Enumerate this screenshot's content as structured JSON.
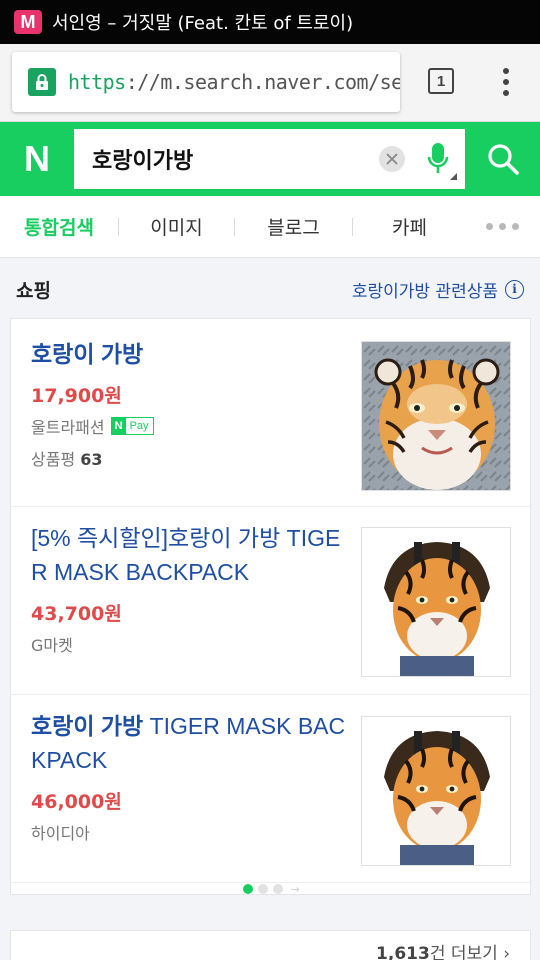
{
  "status_bar": {
    "app_badge": "M",
    "now_playing": "서인영 – 거짓말 (Feat. 칸토 of 트로이)"
  },
  "browser": {
    "url_scheme": "https",
    "url_rest": "://m.search.naver.com/sea",
    "tab_count": "1"
  },
  "naver": {
    "logo": "N",
    "query": "호랑이가방"
  },
  "tabs": [
    {
      "label": "통합검색",
      "active": true
    },
    {
      "label": "이미지",
      "active": false
    },
    {
      "label": "블로그",
      "active": false
    },
    {
      "label": "카페",
      "active": false
    }
  ],
  "shopping": {
    "section_title": "쇼핑",
    "related_link": "호랑이가방 관련상품",
    "info_glyph": "i",
    "products": [
      {
        "title_highlight": "호랑이 가방",
        "title_rest": "",
        "price": "17,900",
        "currency": "원",
        "mall": "울트라패션",
        "npay_n": "N",
        "npay_text": "Pay",
        "review_label": "상품평",
        "review_count": "63"
      },
      {
        "title_highlight": "[5% 즉시할인]호랑이 가방",
        "title_rest": " TIGER MASK BACKPACK",
        "price": "43,700",
        "currency": "원",
        "mall": "G마켓"
      },
      {
        "title_highlight": "호랑이 가방",
        "title_rest": " TIGER MASK BACKPACK",
        "price": "46,000",
        "currency": "원",
        "mall": "하이디아"
      }
    ],
    "pager": {
      "pages": 3,
      "current": 1,
      "arrow": "→"
    },
    "more_count": "1,613",
    "more_label": "건 더보기 ›"
  },
  "colors": {
    "naver_green": "#19ce60",
    "link_blue": "#1f4fa5",
    "price_red": "#e04a4a",
    "app_badge_pink": "#e8336d"
  }
}
